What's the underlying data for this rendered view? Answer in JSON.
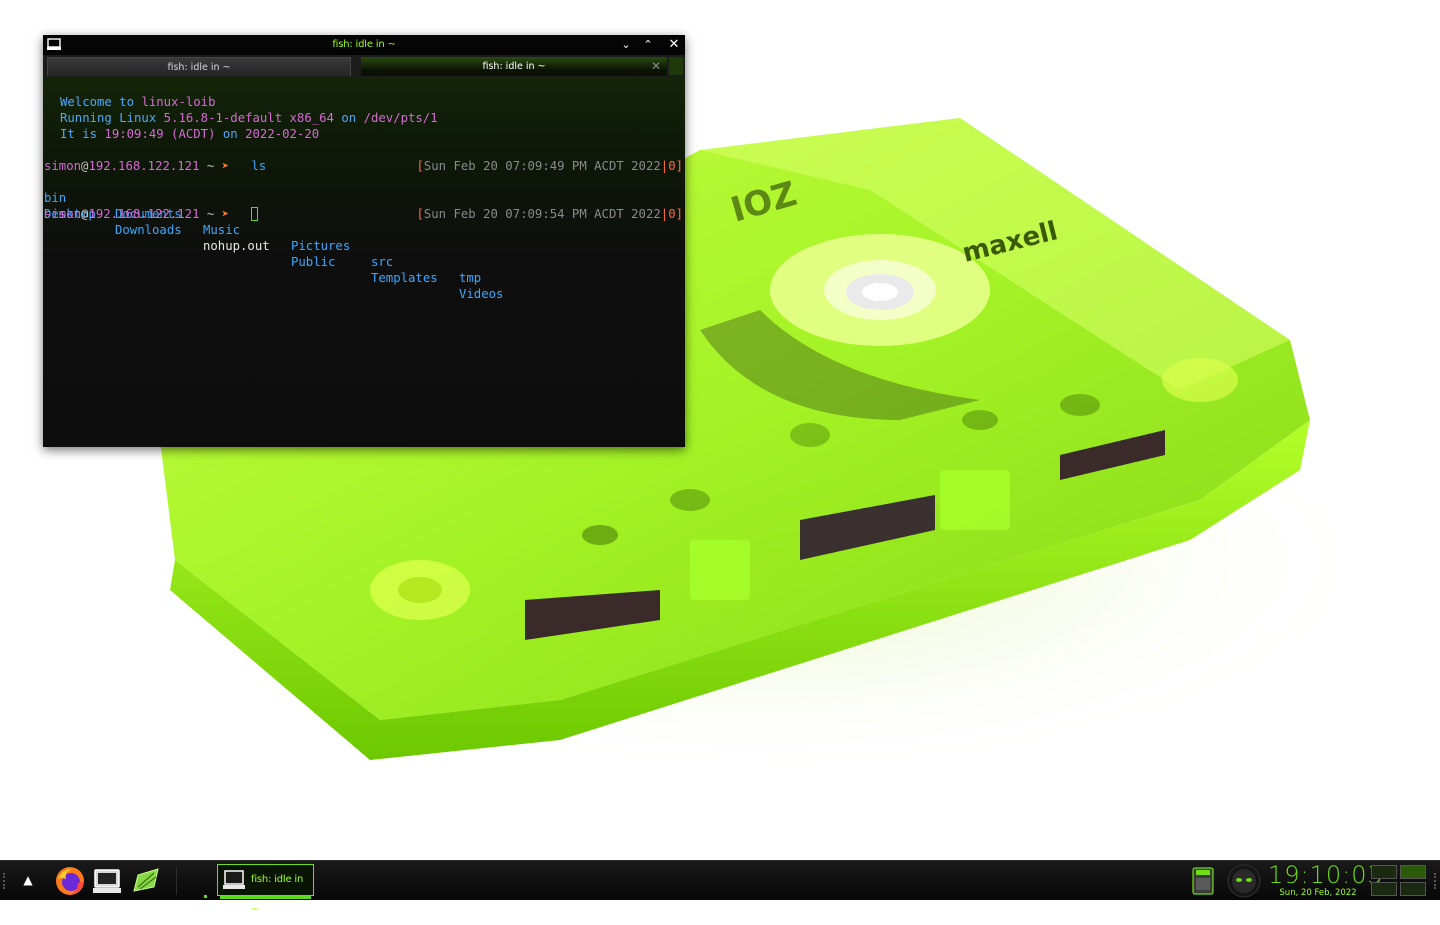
{
  "terminal": {
    "window_title": "fish: idle in ~",
    "tabs": [
      {
        "label": "fish: idle in ~",
        "active": false
      },
      {
        "label": "fish: idle in ~",
        "active": true
      }
    ],
    "controls": {
      "minimize": "⌄",
      "maximize": "⌃",
      "close": "✕"
    },
    "tab_close": "✕",
    "motd": {
      "welcome_prefix": "Welcome to ",
      "welcome_host": "linux-loib",
      "running_prefix": "Running Linux ",
      "kernel": "5.16.8-1-default",
      "arch": " x86_64",
      "on": " on ",
      "tty": "/dev/pts/1",
      "time_prefix": "It is ",
      "time": "19:09:49",
      "tz": " (ACDT)",
      "date": "2022-02-20"
    },
    "prompt": {
      "user": "simon",
      "at": "@",
      "host": "192.168.122.121",
      "cwd": " ~ ",
      "arrow": "➤"
    },
    "command_1": "ls",
    "rprompt_1": {
      "open": "[",
      "text": "Sun Feb 20 07:09:49 PM ACDT 2022",
      "sep": "|",
      "code": "0",
      "close": "]"
    },
    "ls_output": {
      "row1": [
        {
          "name": "bin",
          "type": "dir"
        },
        {
          "name": "Documents",
          "type": "dir"
        },
        {
          "name": "Music",
          "type": "dir"
        },
        {
          "name": "Pictures",
          "type": "dir"
        },
        {
          "name": "src",
          "type": "dir"
        },
        {
          "name": "tmp",
          "type": "dir"
        }
      ],
      "row2": [
        {
          "name": "Desktop",
          "type": "dir"
        },
        {
          "name": "Downloads",
          "type": "dir"
        },
        {
          "name": "nohup.out",
          "type": "file"
        },
        {
          "name": "Public",
          "type": "dir"
        },
        {
          "name": "Templates",
          "type": "dir"
        },
        {
          "name": "Videos",
          "type": "dir"
        }
      ]
    },
    "rprompt_2": {
      "open": "[",
      "text": "Sun Feb 20 07:09:54 PM ACDT 2022",
      "sep": "|",
      "code": "0",
      "close": "]"
    }
  },
  "wallpaper": {
    "brand_text": "maxell",
    "label_fragment": "IOZ"
  },
  "taskbar": {
    "show_desktop_icon": "up-arrow-icon",
    "launchers": [
      "firefox-icon",
      "terminal-icon",
      "text-editor-icon"
    ],
    "task_label": "fish: idle in ~",
    "clock_time": "19:10:03",
    "clock_date": "Sun, 20 Feb, 2022"
  },
  "colors": {
    "accent": "#6fdc14",
    "terminal_bg": "#0d0d0d",
    "prompt_pink": "#d46ad4",
    "ls_blue": "#3aa8ff",
    "arrow_orange": "#ff7a2a"
  }
}
